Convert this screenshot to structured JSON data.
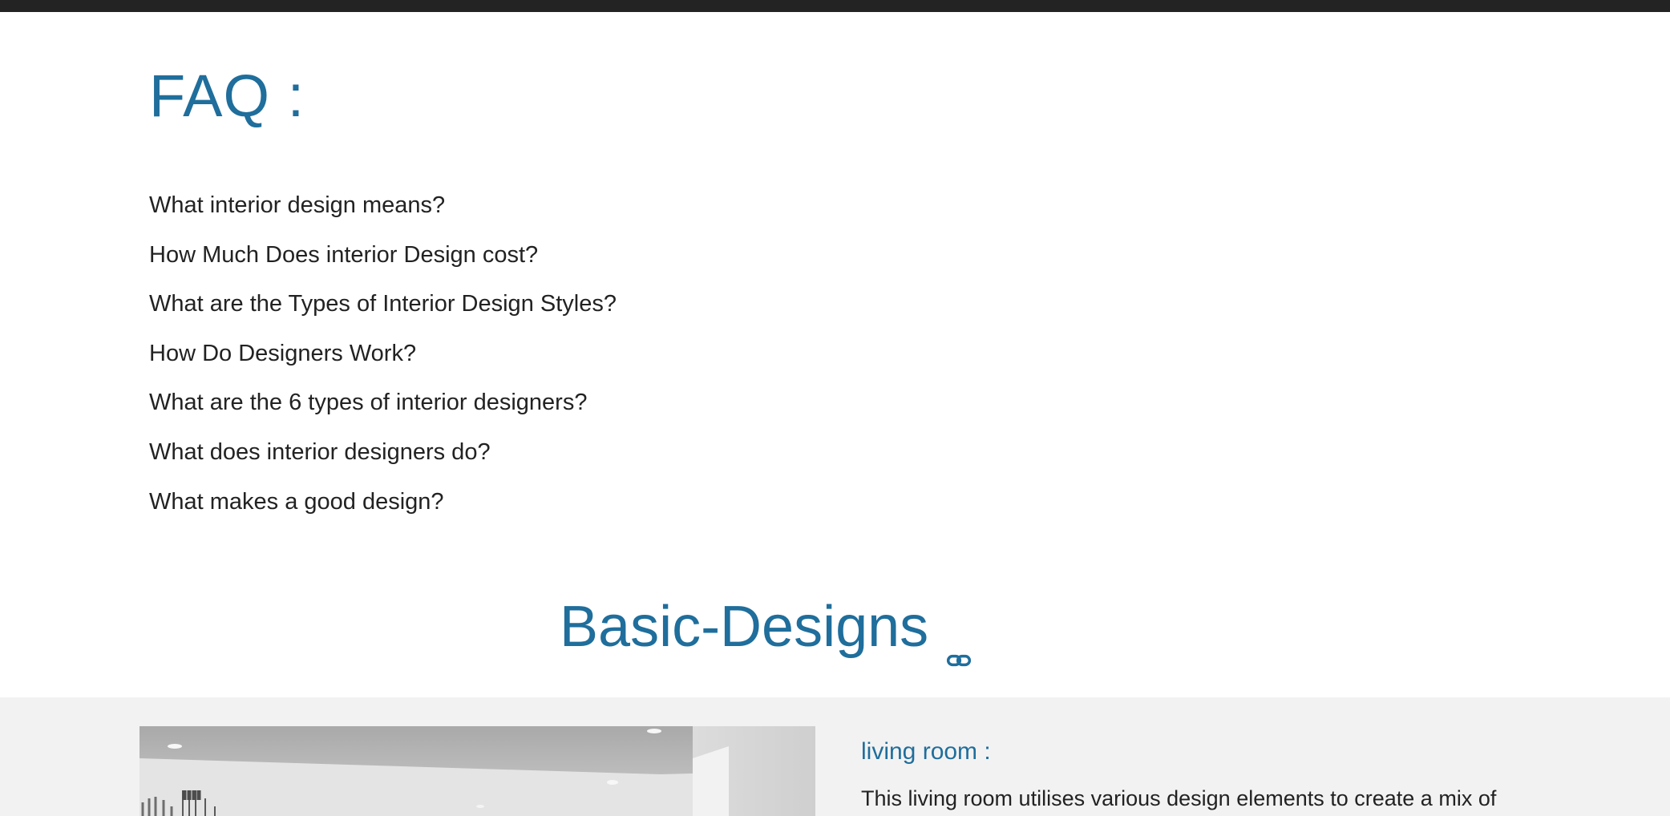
{
  "faq": {
    "title": "FAQ :",
    "questions": [
      "What interior design means?",
      "How Much Does interior Design cost?",
      "What are the Types of Interior Design Styles?",
      "How Do Designers Work?",
      "What are the 6 types of interior designers?",
      "What does interior designers do?",
      "What makes a good design?"
    ]
  },
  "basic_designs": {
    "title": "Basic-Designs",
    "anchor_icon": "link-icon"
  },
  "living_room": {
    "subtitle": "living room :",
    "text": "This living room utilises various design elements to create a mix of"
  },
  "colors": {
    "accent": "#1f6e9c",
    "topbar": "#232323",
    "band": "#f2f2f2",
    "text": "#222222"
  }
}
